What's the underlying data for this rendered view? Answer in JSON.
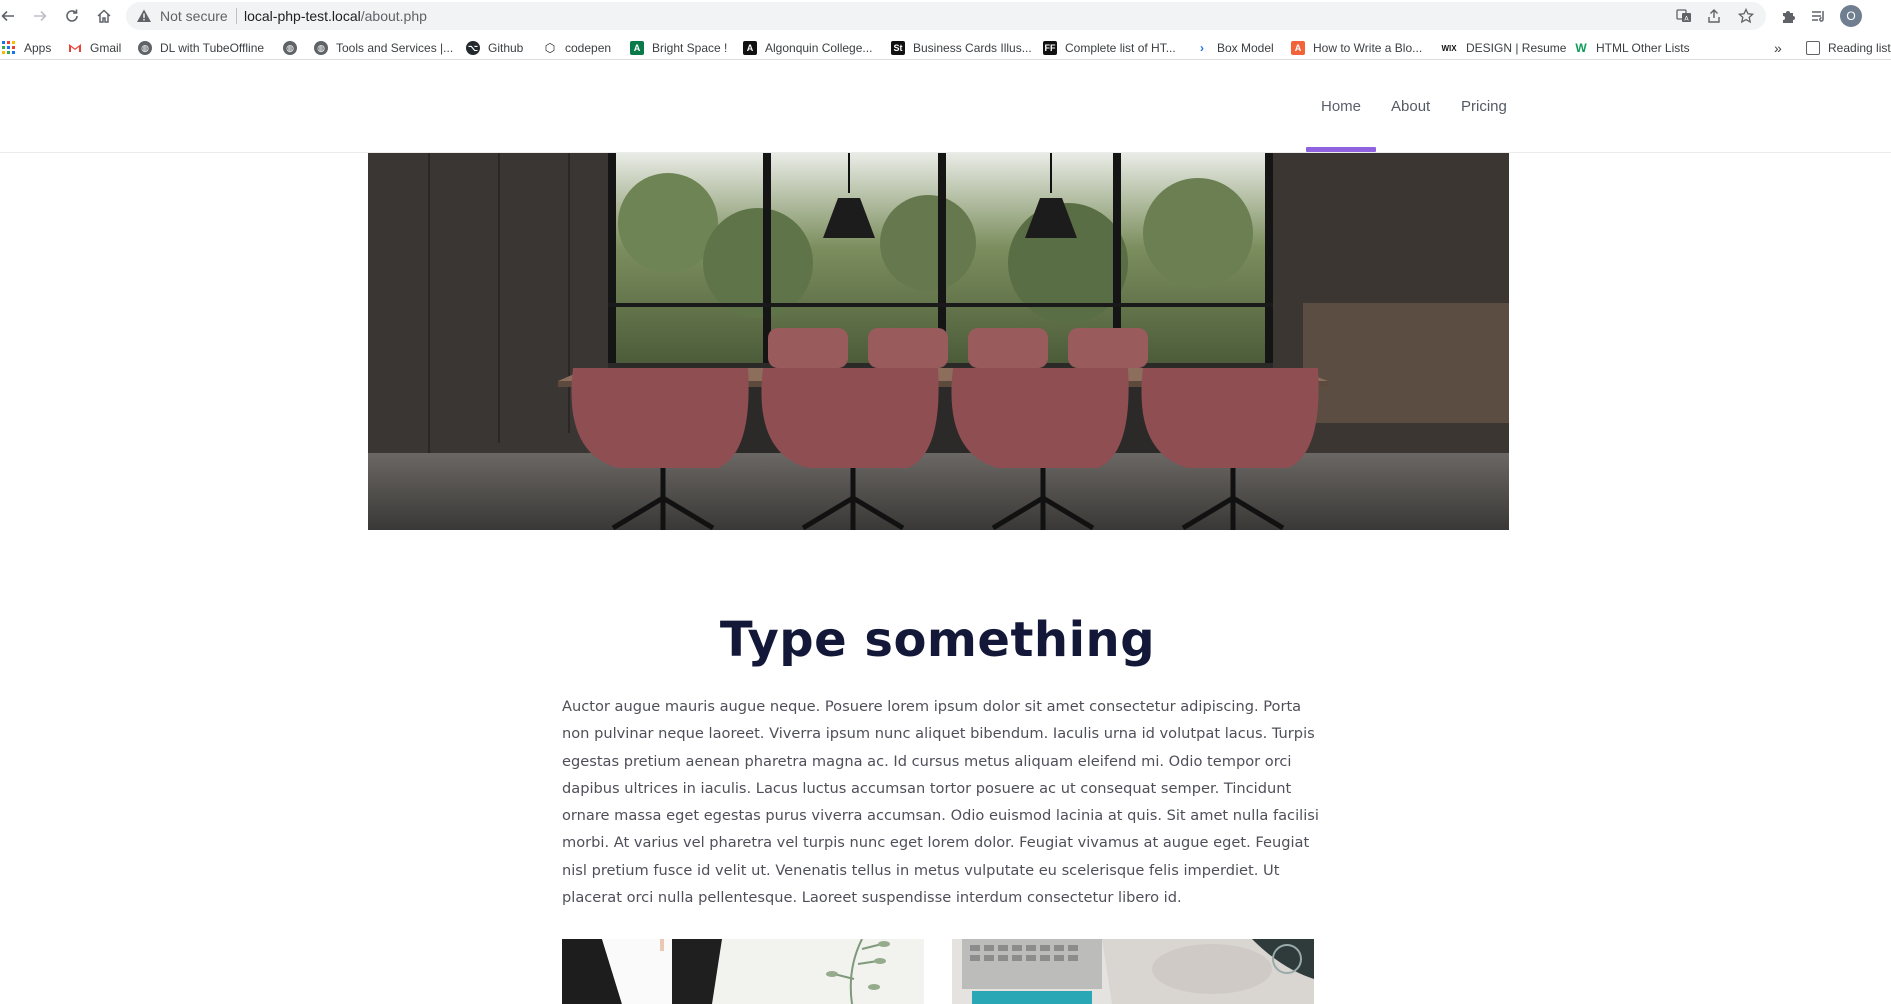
{
  "browser": {
    "omnibox": {
      "security_label": "Not secure",
      "url_host": "local-php-test.local",
      "url_path": "/about.php"
    },
    "profile_initial": "O",
    "bookmarks": [
      {
        "label": "Apps",
        "icon": "apps-grid-icon"
      },
      {
        "label": "Gmail",
        "icon": "gmail-icon"
      },
      {
        "label": "DL with TubeOffline",
        "icon": "globe-icon"
      },
      {
        "label": "",
        "icon": "globe-icon"
      },
      {
        "label": "Tools and Services |...",
        "icon": "globe-icon"
      },
      {
        "label": "Github",
        "icon": "github-icon"
      },
      {
        "label": "codepen",
        "icon": "codepen-icon"
      },
      {
        "label": "Bright Space !",
        "icon": "brightspace-icon"
      },
      {
        "label": "Algonquin College...",
        "icon": "algonquin-icon"
      },
      {
        "label": "Business Cards Illus...",
        "icon": "st-icon"
      },
      {
        "label": "Complete list of HT...",
        "icon": "ff-icon"
      },
      {
        "label": "Box Model",
        "icon": "terminal-icon"
      },
      {
        "label": "How to Write a Blo...",
        "icon": "blog-icon"
      },
      {
        "label": "DESIGN | Resume",
        "icon": "wix-icon"
      },
      {
        "label": "HTML Other Lists",
        "icon": "w-icon"
      }
    ],
    "more_bookmarks": "»",
    "reading_list": "Reading list"
  },
  "site": {
    "nav": {
      "home": "Home",
      "about": "About",
      "pricing": "Pricing",
      "active": "Home"
    },
    "hero_alt": "Conference room",
    "title": "Type something",
    "body": "Auctor augue mauris augue neque. Posuere lorem ipsum dolor sit amet consectetur adipiscing. Porta non pulvinar neque laoreet. Viverra ipsum nunc aliquet bibendum. Iaculis urna id volutpat lacus. Turpis egestas pretium aenean pharetra magna ac. Id cursus metus aliquam eleifend mi. Odio tempor orci dapibus ultrices in iaculis. Lacus luctus accumsan tortor posuere ac ut consequat semper. Tincidunt ornare massa eget egestas purus viverra accumsan. Odio euismod lacinia at quis. Sit amet nulla facilisi morbi. At varius vel pharetra vel turpis nunc eget lorem dolor. Feugiat vivamus at augue eget. Feugiat nisl pretium fusce id velit ut. Venenatis tellus in metus vulputate eu scelerisque felis imperdiet. Ut placerat orci nulla pellentesque. Laoreet suspendisse interdum consectetur libero id."
  },
  "colors": {
    "accent": "#8f63e0",
    "title": "#141838",
    "body_text": "#4f4f5a"
  }
}
